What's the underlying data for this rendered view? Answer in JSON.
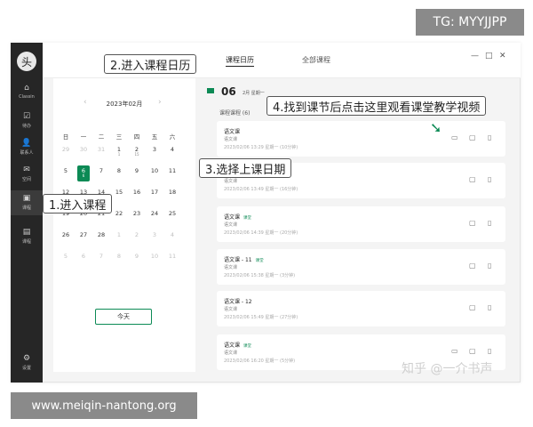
{
  "watermark_top": "TG: MYYJJPP",
  "watermark_bottom": "www.meiqin-nantong.org",
  "watermark_zhihu": "知乎 @一介书声",
  "sidebar": {
    "logo": "头",
    "items": [
      {
        "icon": "home-icon",
        "glyph": "⌂",
        "label": "Classin"
      },
      {
        "icon": "task-icon",
        "glyph": "☑",
        "label": "待办"
      },
      {
        "icon": "contacts-icon",
        "glyph": "👤",
        "label": "联系人"
      },
      {
        "icon": "inbox-icon",
        "glyph": "✉",
        "label": "空间"
      },
      {
        "icon": "course-icon",
        "glyph": "▣",
        "label": "课程"
      },
      {
        "icon": "stats-icon",
        "glyph": "▤",
        "label": "课程"
      },
      {
        "icon": "settings-icon",
        "glyph": "⚙",
        "label": "设置"
      }
    ]
  },
  "tabs": {
    "calendar": "课程日历",
    "all": "全部课程"
  },
  "window_controls": {
    "minimize": "—",
    "maximize": "□",
    "close": "✕"
  },
  "calendar": {
    "title": "2023年02月",
    "prev": "‹",
    "next": "›",
    "weekdays": [
      "日",
      "一",
      "二",
      "三",
      "四",
      "五",
      "六"
    ],
    "rows": [
      [
        {
          "d": "29",
          "o": true
        },
        {
          "d": "30",
          "o": true
        },
        {
          "d": "31",
          "o": true
        },
        {
          "d": "1",
          "dot": "1"
        },
        {
          "d": "2",
          "dot": "15"
        },
        {
          "d": "3"
        },
        {
          "d": "4"
        }
      ],
      [
        {
          "d": "5"
        },
        {
          "d": "6",
          "sel": true,
          "dot": "6"
        },
        {
          "d": "7"
        },
        {
          "d": "8"
        },
        {
          "d": "9"
        },
        {
          "d": "10"
        },
        {
          "d": "11"
        }
      ],
      [
        {
          "d": "12"
        },
        {
          "d": "13"
        },
        {
          "d": "14"
        },
        {
          "d": "15"
        },
        {
          "d": "16"
        },
        {
          "d": "17"
        },
        {
          "d": "18"
        }
      ],
      [
        {
          "d": "19"
        },
        {
          "d": "20"
        },
        {
          "d": "21"
        },
        {
          "d": "22"
        },
        {
          "d": "23"
        },
        {
          "d": "24"
        },
        {
          "d": "25"
        }
      ],
      [
        {
          "d": "26"
        },
        {
          "d": "27"
        },
        {
          "d": "28"
        },
        {
          "d": "1",
          "o": true
        },
        {
          "d": "2",
          "o": true
        },
        {
          "d": "3",
          "o": true
        },
        {
          "d": "4",
          "o": true
        }
      ],
      [
        {
          "d": "5",
          "o": true
        },
        {
          "d": "6",
          "o": true
        },
        {
          "d": "7",
          "o": true
        },
        {
          "d": "8",
          "o": true
        },
        {
          "d": "9",
          "o": true
        },
        {
          "d": "10",
          "o": true
        },
        {
          "d": "11",
          "o": true
        }
      ]
    ],
    "today_button": "今天"
  },
  "list": {
    "day": "06",
    "month": "2月 星期一",
    "count": "课程课程 (6)",
    "cards": [
      {
        "title": "语文课",
        "tag": "",
        "sub": "语文课",
        "time": "2023/02/06 13:29 星期一 (10分钟)",
        "video": true
      },
      {
        "title": "语文课",
        "tag": "",
        "sub": "语文课",
        "time": "2023/02/06 13:49 星期一 (16分钟)",
        "video": false
      },
      {
        "title": "语文课",
        "tag": "课堂",
        "sub": "语文课",
        "time": "2023/02/06 14:39 星期一 (20分钟)",
        "video": false
      },
      {
        "title": "语文课 - 11",
        "tag": "课堂",
        "sub": "语文课",
        "time": "2023/02/06 15:38 星期一 (3分钟)",
        "video": false
      },
      {
        "title": "语文课 - 12",
        "tag": "",
        "sub": "语文课",
        "time": "2023/02/06 15:49 星期一 (27分钟)",
        "video": false
      },
      {
        "title": "语文课",
        "tag": "课堂",
        "sub": "语文课",
        "time": "2023/02/06 16:20 星期一 (5分钟)",
        "video": true
      }
    ]
  },
  "callouts": {
    "enter_course": "1.进入课程",
    "enter_calendar": "2.进入课程日历",
    "select_date": "3.选择上课日期",
    "watch_video": "4.找到课节后点击这里观看课堂教学视频"
  },
  "icons": {
    "video": "▭",
    "chat": "▢",
    "file": "▯"
  },
  "colors": {
    "accent": "#0c8a55",
    "sidebar": "#262626"
  }
}
